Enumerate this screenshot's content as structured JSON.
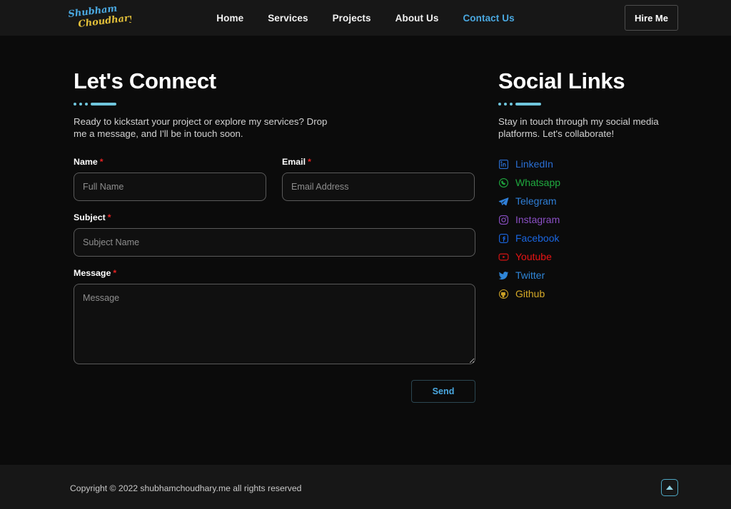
{
  "header": {
    "logo_line1": "Shubham",
    "logo_line2": "Choudhary",
    "logo_color_top": "#4aa8e0",
    "logo_color_bottom": "#e3c03a",
    "nav": [
      {
        "label": "Home",
        "active": false
      },
      {
        "label": "Services",
        "active": false
      },
      {
        "label": "Projects",
        "active": false
      },
      {
        "label": "About Us",
        "active": false
      },
      {
        "label": "Contact Us",
        "active": true
      }
    ],
    "hire_label": "Hire Me",
    "active_color": "#4aa8e0"
  },
  "contact": {
    "title": "Let's Connect",
    "description": "Ready to kickstart your project or explore my services? Drop me a message, and I'll be in touch soon.",
    "accent_color": "#6fc6dd",
    "fields": {
      "name": {
        "label": "Name",
        "required": "*",
        "placeholder": "Full Name",
        "value": ""
      },
      "email": {
        "label": "Email",
        "required": "*",
        "placeholder": "Email Address",
        "value": ""
      },
      "subject": {
        "label": "Subject",
        "required": "*",
        "placeholder": "Subject Name",
        "value": ""
      },
      "message": {
        "label": "Message",
        "required": "*",
        "placeholder": "Message",
        "value": ""
      }
    },
    "send_label": "Send",
    "send_color": "#4aa8e0"
  },
  "social": {
    "title": "Social Links",
    "description": "Stay in touch through my social media platforms. Let's collaborate!",
    "items": [
      {
        "label": "LinkedIn",
        "icon": "linkedin-icon",
        "color": "#2a6fd4"
      },
      {
        "label": "Whatsapp",
        "icon": "whatsapp-icon",
        "color": "#1faa3f"
      },
      {
        "label": "Telegram",
        "icon": "telegram-icon",
        "color": "#2f7fd8"
      },
      {
        "label": "Instagram",
        "icon": "instagram-icon",
        "color": "#8a4fc4"
      },
      {
        "label": "Facebook",
        "icon": "facebook-icon",
        "color": "#1a66e0"
      },
      {
        "label": "Youtube",
        "icon": "youtube-icon",
        "color": "#e81414"
      },
      {
        "label": "Twitter",
        "icon": "twitter-icon",
        "color": "#2f86d8"
      },
      {
        "label": "Github",
        "icon": "github-icon",
        "color": "#d6aa28"
      }
    ]
  },
  "footer": {
    "copyright": "Copyright © 2022 shubhamchoudhary.me all rights reserved",
    "scroll_top_icon": "caret-up-icon"
  }
}
